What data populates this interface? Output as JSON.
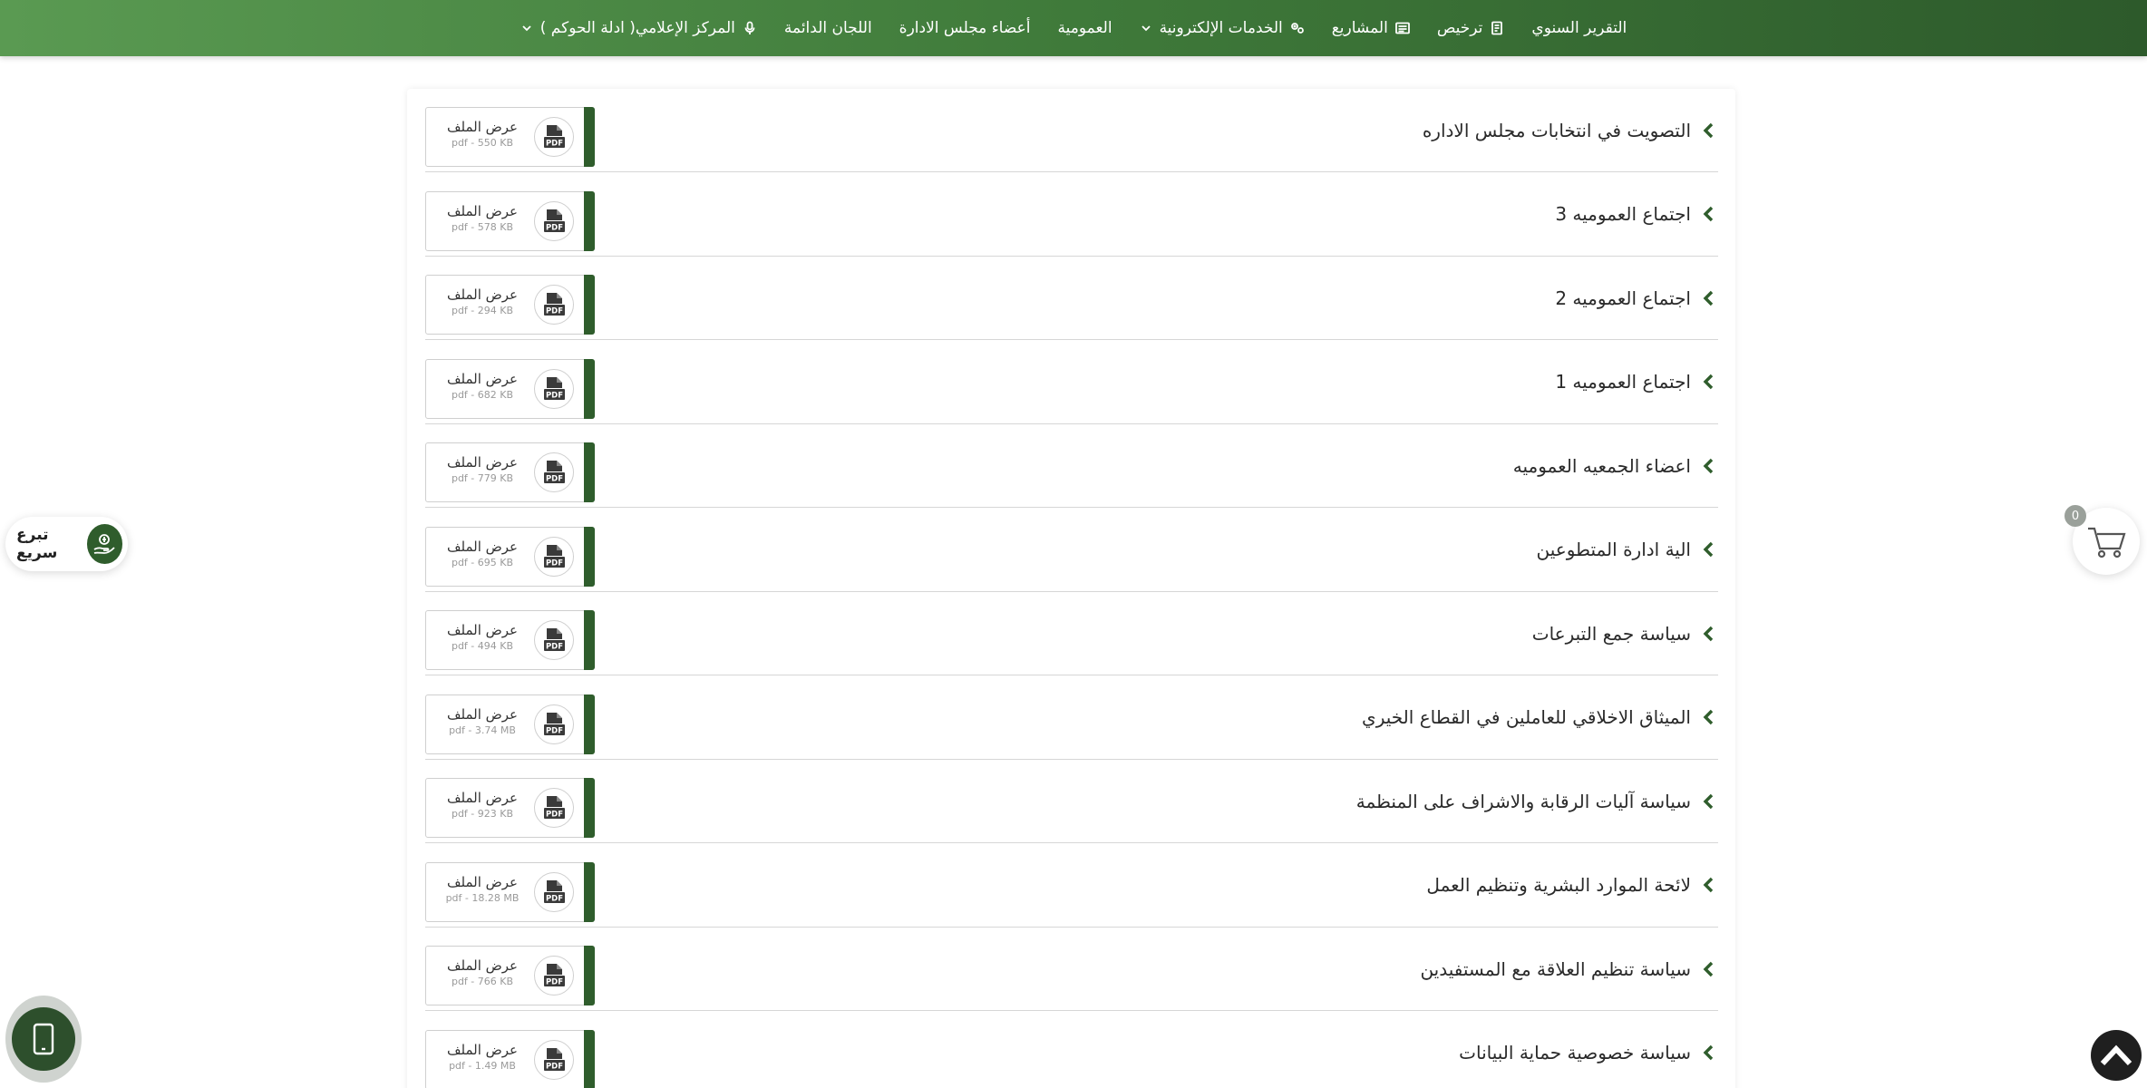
{
  "nav": {
    "items": [
      {
        "label": "التقرير السنوي",
        "icon": "",
        "dropdown": false
      },
      {
        "label": "ترخيص",
        "icon": "license-icon",
        "dropdown": false
      },
      {
        "label": "المشاريع",
        "icon": "projects-icon",
        "dropdown": false
      },
      {
        "label": "الخدمات الإلكترونية",
        "icon": "services-icon",
        "dropdown": true
      },
      {
        "label": "العمومية",
        "icon": "",
        "dropdown": false
      },
      {
        "label": "أعضاء مجلس الادارة",
        "icon": "",
        "dropdown": false
      },
      {
        "label": "اللجان الدائمة",
        "icon": "",
        "dropdown": false
      },
      {
        "label": "المركز الإعلامي( ادلة الحوكم )",
        "icon": "microphone-icon",
        "dropdown": true
      }
    ]
  },
  "documents": [
    {
      "title": "التصويت في انتخابات مجلس الاداره",
      "view_label": "عرض الملف",
      "size": "pdf - 550 KB"
    },
    {
      "title": "اجتماع العموميه 3",
      "view_label": "عرض الملف",
      "size": "pdf - 578 KB"
    },
    {
      "title": "اجتماع العموميه 2",
      "view_label": "عرض الملف",
      "size": "pdf - 294 KB"
    },
    {
      "title": "اجتماع العموميه 1",
      "view_label": "عرض الملف",
      "size": "pdf - 682 KB"
    },
    {
      "title": "اعضاء الجمعيه العموميه",
      "view_label": "عرض الملف",
      "size": "pdf - 779 KB"
    },
    {
      "title": "الية ادارة المتطوعين",
      "view_label": "عرض الملف",
      "size": "pdf - 695 KB"
    },
    {
      "title": "سياسة جمع التبرعات",
      "view_label": "عرض الملف",
      "size": "pdf - 494 KB"
    },
    {
      "title": "الميثاق الاخلاقي للعاملين في القطاع الخيري",
      "view_label": "عرض الملف",
      "size": "pdf - 3.74 MB"
    },
    {
      "title": "سياسة آليات الرقابة والاشراف على المنظمة",
      "view_label": "عرض الملف",
      "size": "pdf - 923 KB"
    },
    {
      "title": "لائحة الموارد البشرية وتنظيم العمل",
      "view_label": "عرض الملف",
      "size": "pdf - 18.28 MB"
    },
    {
      "title": "سياسة تنظيم العلاقة مع المستفيدين",
      "view_label": "عرض الملف",
      "size": "pdf - 766 KB"
    },
    {
      "title": "سياسة خصوصية حماية البيانات",
      "view_label": "عرض الملف",
      "size": "pdf - 1.49 MB"
    }
  ],
  "widgets": {
    "quick_donate_label": "تبرع سريع",
    "cart_count": "0"
  },
  "colors": {
    "accent": "#2f5d2c",
    "nav_start": "#5a9a52",
    "nav_end": "#2d5a2b"
  }
}
